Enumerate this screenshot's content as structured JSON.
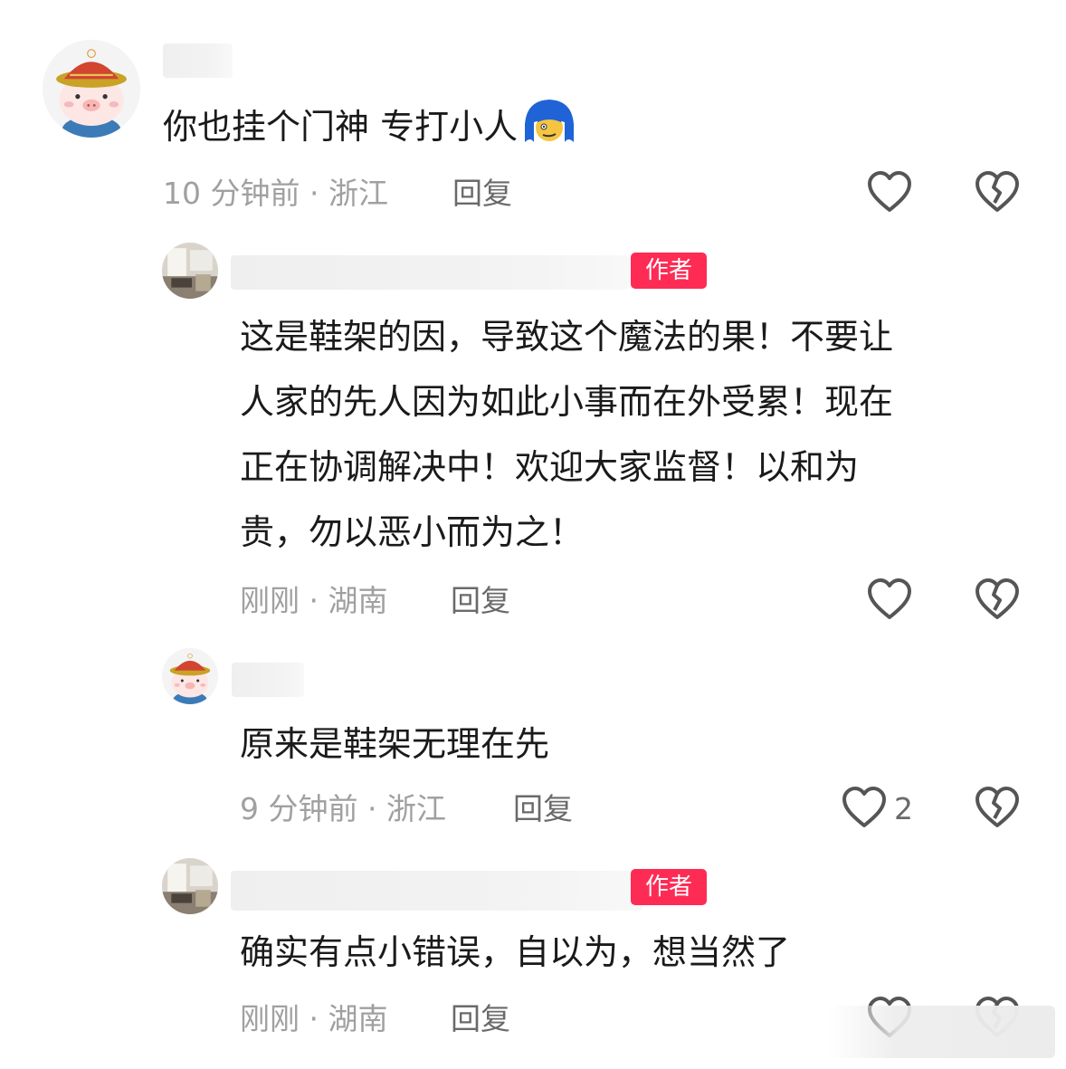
{
  "comments": [
    {
      "id": "c1",
      "avatar": "pig-mandarin-hat-avatar",
      "is_author": false,
      "text_lines": [
        "你也挂个门神 专打小人"
      ],
      "emoji": "blue-hair-face-emoji",
      "meta": "10 分钟前 · 浙江",
      "reply_label": "回复",
      "like_count": ""
    },
    {
      "id": "c2",
      "avatar": "room-photo-avatar",
      "is_author": true,
      "author_badge": "作者",
      "text_lines": [
        "这是鞋架的因，导致这个魔法的果！不要让",
        "人家的先人因为如此小事而在外受累！现在",
        "正在协调解决中！欢迎大家监督！以和为",
        "贵，勿以恶小而为之！"
      ],
      "meta": "刚刚 · 湖南",
      "reply_label": "回复",
      "like_count": ""
    },
    {
      "id": "c3",
      "avatar": "pig-mandarin-hat-avatar",
      "is_author": false,
      "text_lines": [
        "原来是鞋架无理在先"
      ],
      "meta": "9 分钟前 · 浙江",
      "reply_label": "回复",
      "like_count": "2"
    },
    {
      "id": "c4",
      "avatar": "room-photo-avatar",
      "is_author": true,
      "author_badge": "作者",
      "text_lines": [
        "确实有点小错误，自以为，想当然了"
      ],
      "meta": "刚刚 · 湖南",
      "reply_label": "回复",
      "like_count": ""
    }
  ],
  "colors": {
    "author_badge_bg": "#fe2c55",
    "meta_text": "#a0a0a0",
    "reply_text": "#6a6a6a",
    "icon_stroke": "#555555"
  }
}
